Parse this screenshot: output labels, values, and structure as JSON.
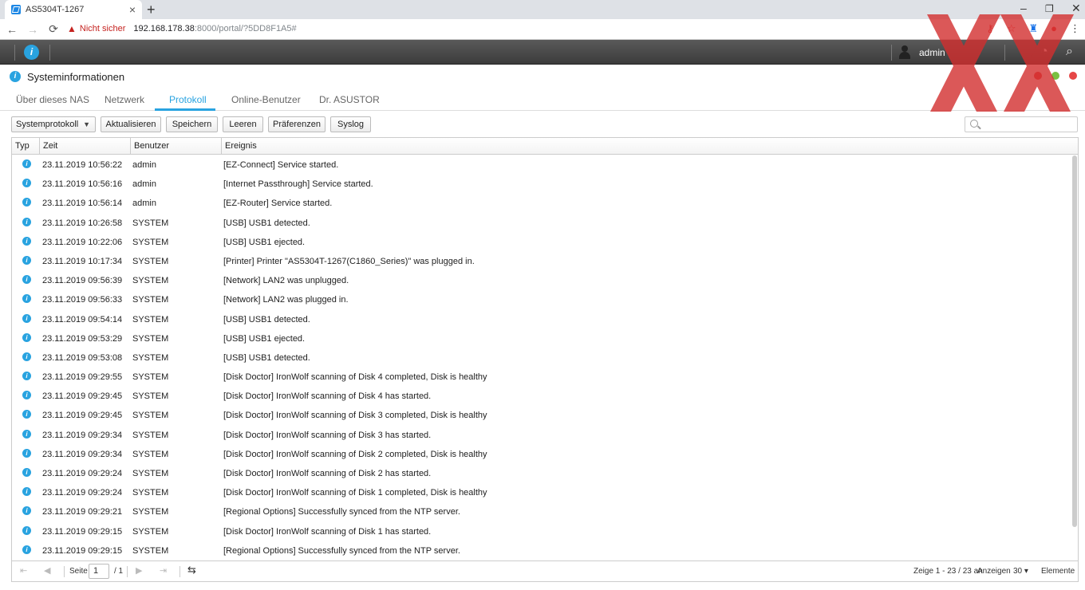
{
  "browser": {
    "tab_title": "AS5304T-1267",
    "tab_close": "×",
    "new_tab": "+",
    "win_min": "–",
    "win_max": "❐",
    "win_close": "✕",
    "back": "←",
    "forward": "→",
    "reload": "⟳",
    "insecure_label": "Nicht sicher",
    "url_host": "192.168.178.38",
    "url_rest": ":8000/portal/?5DD8F1A5#",
    "menu": "⋮"
  },
  "adm": {
    "user": "admin"
  },
  "window": {
    "title": "Systeminformationen",
    "buttons": {
      "minimize": "#e64646",
      "maximize": "#7ac142",
      "close": "#e64646"
    }
  },
  "tabs": [
    {
      "label": "Über dieses NAS"
    },
    {
      "label": "Netzwerk"
    },
    {
      "label": "Protokoll"
    },
    {
      "label": "Online-Benutzer"
    },
    {
      "label": "Dr. ASUSTOR"
    }
  ],
  "toolbar": {
    "log_select": "Systemprotokoll",
    "refresh": "Aktualisieren",
    "save": "Speichern",
    "clear": "Leeren",
    "prefs": "Präferenzen",
    "syslog": "Syslog"
  },
  "grid": {
    "columns": [
      "Typ",
      "Zeit",
      "Benutzer",
      "Ereignis"
    ],
    "rows": [
      {
        "time": "23.11.2019 10:56:22",
        "user": "admin",
        "event": "[EZ-Connect] Service started."
      },
      {
        "time": "23.11.2019 10:56:16",
        "user": "admin",
        "event": "[Internet Passthrough] Service started."
      },
      {
        "time": "23.11.2019 10:56:14",
        "user": "admin",
        "event": "[EZ-Router] Service started."
      },
      {
        "time": "23.11.2019 10:26:58",
        "user": "SYSTEM",
        "event": "[USB] USB1 detected."
      },
      {
        "time": "23.11.2019 10:22:06",
        "user": "SYSTEM",
        "event": "[USB] USB1 ejected."
      },
      {
        "time": "23.11.2019 10:17:34",
        "user": "SYSTEM",
        "event": "[Printer] Printer \"AS5304T-1267(C1860_Series)\" was plugged in."
      },
      {
        "time": "23.11.2019 09:56:39",
        "user": "SYSTEM",
        "event": "[Network] LAN2 was unplugged."
      },
      {
        "time": "23.11.2019 09:56:33",
        "user": "SYSTEM",
        "event": "[Network] LAN2 was plugged in."
      },
      {
        "time": "23.11.2019 09:54:14",
        "user": "SYSTEM",
        "event": "[USB] USB1 detected."
      },
      {
        "time": "23.11.2019 09:53:29",
        "user": "SYSTEM",
        "event": "[USB] USB1 ejected."
      },
      {
        "time": "23.11.2019 09:53:08",
        "user": "SYSTEM",
        "event": "[USB] USB1 detected."
      },
      {
        "time": "23.11.2019 09:29:55",
        "user": "SYSTEM",
        "event": "[Disk Doctor] IronWolf scanning of Disk 4 completed, Disk is healthy"
      },
      {
        "time": "23.11.2019 09:29:45",
        "user": "SYSTEM",
        "event": "[Disk Doctor] IronWolf scanning of Disk 4 has started."
      },
      {
        "time": "23.11.2019 09:29:45",
        "user": "SYSTEM",
        "event": "[Disk Doctor] IronWolf scanning of Disk 3 completed, Disk is healthy"
      },
      {
        "time": "23.11.2019 09:29:34",
        "user": "SYSTEM",
        "event": "[Disk Doctor] IronWolf scanning of Disk 3 has started."
      },
      {
        "time": "23.11.2019 09:29:34",
        "user": "SYSTEM",
        "event": "[Disk Doctor] IronWolf scanning of Disk 2 completed, Disk is healthy"
      },
      {
        "time": "23.11.2019 09:29:24",
        "user": "SYSTEM",
        "event": "[Disk Doctor] IronWolf scanning of Disk 2 has started."
      },
      {
        "time": "23.11.2019 09:29:24",
        "user": "SYSTEM",
        "event": "[Disk Doctor] IronWolf scanning of Disk 1 completed, Disk is healthy"
      },
      {
        "time": "23.11.2019 09:29:21",
        "user": "SYSTEM",
        "event": "[Regional Options] Successfully synced from the NTP server."
      },
      {
        "time": "23.11.2019 09:29:15",
        "user": "SYSTEM",
        "event": "[Disk Doctor] IronWolf scanning of Disk 1 has started."
      },
      {
        "time": "23.11.2019 09:29:15",
        "user": "SYSTEM",
        "event": "[Regional Options] Successfully synced from the NTP server."
      }
    ]
  },
  "pager": {
    "page_label": "Seite",
    "page_value": "1",
    "page_total": "/ 1",
    "showing": "Zeige 1 - 23 / 23 an",
    "display_label": "Anzeigen",
    "per_page": "30",
    "items_label": "Elemente"
  },
  "colors": {
    "accent": "#29a3e0",
    "watermark": "#d32f2f"
  }
}
